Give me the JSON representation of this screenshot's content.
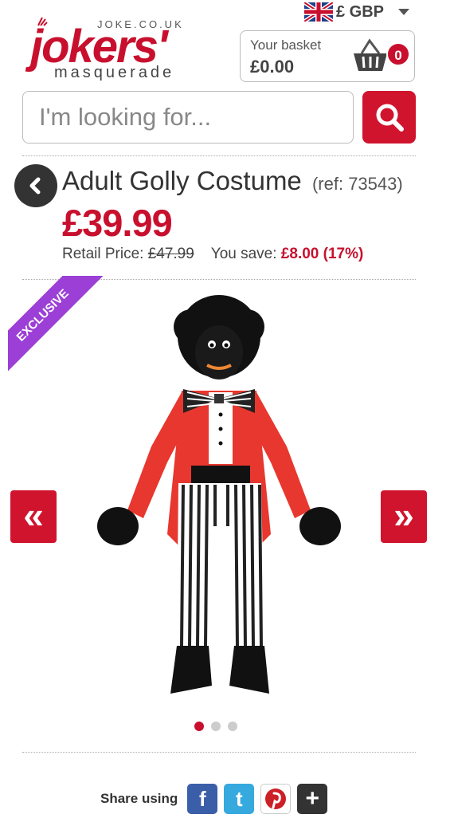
{
  "header": {
    "site_url": "JOKE.CO.UK",
    "logo_word": "jokers'",
    "logo_sub": "masquerade",
    "currency": "£ GBP",
    "basket_label": "Your basket",
    "basket_total": "£0.00",
    "basket_count": "0"
  },
  "search": {
    "placeholder": "I'm looking for..."
  },
  "product": {
    "title": "Adult Golly Costume",
    "ref": "(ref: 73543)",
    "price": "£39.99",
    "retail_label": "Retail Price:",
    "retail_price": "£47.99",
    "save_label": "You save:",
    "save_value": "£8.00 (17%)",
    "badge": "EXCLUSIVE"
  },
  "gallery": {
    "prev": "«",
    "next": "»",
    "slide_count": 3,
    "active_slide": 1
  },
  "share": {
    "label": "Share using",
    "networks": [
      "facebook-icon",
      "twitter-icon",
      "pinterest-icon",
      "google-plus-icon"
    ]
  },
  "colors": {
    "brand_red": "#c8102e",
    "ribbon_purple": "#9b3fd6"
  }
}
